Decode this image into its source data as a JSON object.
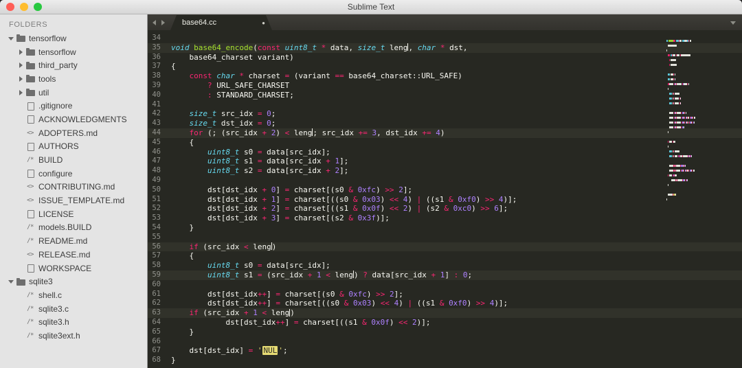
{
  "window": {
    "title": "Sublime Text"
  },
  "colors": {
    "editor_bg": "#272822",
    "sidebar_bg": "#e4e4e4",
    "tab_active_bg": "#272822",
    "plain": "#f8f8f2",
    "keyword": "#f92672",
    "type": "#66d9ef",
    "function": "#a6e22e",
    "number": "#ae81ff",
    "string": "#e6db74",
    "line_number": "#90918b",
    "line_highlight": "#31322a",
    "titlebar_close": "#ff5f57",
    "titlebar_minimize": "#ffbd2e",
    "titlebar_zoom": "#28c840"
  },
  "sidebar": {
    "header": "FOLDERS",
    "items": [
      {
        "label": "tensorflow",
        "type": "folder-open",
        "level": 0
      },
      {
        "label": "tensorflow",
        "type": "folder",
        "level": 1
      },
      {
        "label": "third_party",
        "type": "folder",
        "level": 1
      },
      {
        "label": "tools",
        "type": "folder",
        "level": 1
      },
      {
        "label": "util",
        "type": "folder",
        "level": 1
      },
      {
        "label": ".gitignore",
        "type": "doc",
        "level": 1
      },
      {
        "label": "ACKNOWLEDGMENTS",
        "type": "doc",
        "level": 1
      },
      {
        "label": "ADOPTERS.md",
        "type": "code",
        "level": 1
      },
      {
        "label": "AUTHORS",
        "type": "doc",
        "level": 1
      },
      {
        "label": "BUILD",
        "type": "src",
        "level": 1
      },
      {
        "label": "configure",
        "type": "doc",
        "level": 1
      },
      {
        "label": "CONTRIBUTING.md",
        "type": "code",
        "level": 1
      },
      {
        "label": "ISSUE_TEMPLATE.md",
        "type": "code",
        "level": 1
      },
      {
        "label": "LICENSE",
        "type": "doc",
        "level": 1
      },
      {
        "label": "models.BUILD",
        "type": "src",
        "level": 1
      },
      {
        "label": "README.md",
        "type": "src",
        "level": 1
      },
      {
        "label": "RELEASE.md",
        "type": "code",
        "level": 1
      },
      {
        "label": "WORKSPACE",
        "type": "doc",
        "level": 1
      },
      {
        "label": "sqlite3",
        "type": "folder-open",
        "level": 0
      },
      {
        "label": "shell.c",
        "type": "src",
        "level": 1
      },
      {
        "label": "sqlite3.c",
        "type": "src",
        "level": 1
      },
      {
        "label": "sqlite3.h",
        "type": "src",
        "level": 1
      },
      {
        "label": "sqlite3ext.h",
        "type": "src",
        "level": 1
      }
    ]
  },
  "tab_bar": {
    "tabs": [
      {
        "label": "base64.cc",
        "modified": true,
        "active": true
      }
    ]
  },
  "editor": {
    "first_visible_line": 34,
    "last_visible_line": 68,
    "lines": [
      {
        "n": 34,
        "t": []
      },
      {
        "n": 35,
        "hl": true,
        "t": [
          [
            "t",
            "void "
          ],
          [
            "f",
            "base64_encode"
          ],
          [
            "p",
            "("
          ],
          [
            "k",
            "const "
          ],
          [
            "t",
            "uint8_t "
          ],
          [
            "o",
            "* "
          ],
          [
            "p",
            "data, "
          ],
          [
            "t",
            "size_t "
          ],
          [
            "p",
            "leng"
          ],
          [
            "caret",
            ""
          ],
          [
            "p",
            ", "
          ],
          [
            "t",
            "char "
          ],
          [
            "o",
            "* "
          ],
          [
            "p",
            "dst,"
          ]
        ]
      },
      {
        "n": 36,
        "t": [
          [
            "p",
            "    base64_charset variant)"
          ]
        ]
      },
      {
        "n": 37,
        "t": [
          [
            "p",
            "{"
          ]
        ]
      },
      {
        "n": 38,
        "t": [
          [
            "p",
            "    "
          ],
          [
            "k",
            "const "
          ],
          [
            "t",
            "char "
          ],
          [
            "o",
            "* "
          ],
          [
            "p",
            "charset "
          ],
          [
            "o",
            "= "
          ],
          [
            "p",
            "(variant "
          ],
          [
            "o",
            "== "
          ],
          [
            "p",
            "base64_charset::URL_SAFE)"
          ]
        ]
      },
      {
        "n": 39,
        "t": [
          [
            "p",
            "        "
          ],
          [
            "o",
            "? "
          ],
          [
            "p",
            "URL_SAFE_CHARSET"
          ]
        ]
      },
      {
        "n": 40,
        "t": [
          [
            "p",
            "        "
          ],
          [
            "o",
            ": "
          ],
          [
            "p",
            "STANDARD_CHARSET;"
          ]
        ]
      },
      {
        "n": 41,
        "t": []
      },
      {
        "n": 42,
        "t": [
          [
            "p",
            "    "
          ],
          [
            "t",
            "size_t "
          ],
          [
            "p",
            "src_idx "
          ],
          [
            "o",
            "= "
          ],
          [
            "n",
            "0"
          ],
          [
            "p",
            ";"
          ]
        ]
      },
      {
        "n": 43,
        "t": [
          [
            "p",
            "    "
          ],
          [
            "t",
            "size_t "
          ],
          [
            "p",
            "dst_idx "
          ],
          [
            "o",
            "= "
          ],
          [
            "n",
            "0"
          ],
          [
            "p",
            ";"
          ]
        ]
      },
      {
        "n": 44,
        "hl": true,
        "t": [
          [
            "p",
            "    "
          ],
          [
            "k",
            "for "
          ],
          [
            "p",
            "(; (src_idx "
          ],
          [
            "o",
            "+ "
          ],
          [
            "n",
            "2"
          ],
          [
            "p",
            ") "
          ],
          [
            "o",
            "< "
          ],
          [
            "p",
            "leng"
          ],
          [
            "caret",
            ""
          ],
          [
            "p",
            "; src_idx "
          ],
          [
            "o",
            "+= "
          ],
          [
            "n",
            "3"
          ],
          [
            "p",
            ", dst_idx "
          ],
          [
            "o",
            "+= "
          ],
          [
            "n",
            "4"
          ],
          [
            "p",
            ")"
          ]
        ]
      },
      {
        "n": 45,
        "t": [
          [
            "p",
            "    {"
          ]
        ]
      },
      {
        "n": 46,
        "t": [
          [
            "p",
            "        "
          ],
          [
            "t",
            "uint8_t "
          ],
          [
            "p",
            "s0 "
          ],
          [
            "o",
            "= "
          ],
          [
            "p",
            "data[src_idx];"
          ]
        ]
      },
      {
        "n": 47,
        "t": [
          [
            "p",
            "        "
          ],
          [
            "t",
            "uint8_t "
          ],
          [
            "p",
            "s1 "
          ],
          [
            "o",
            "= "
          ],
          [
            "p",
            "data[src_idx "
          ],
          [
            "o",
            "+ "
          ],
          [
            "n",
            "1"
          ],
          [
            "p",
            "];"
          ]
        ]
      },
      {
        "n": 48,
        "t": [
          [
            "p",
            "        "
          ],
          [
            "t",
            "uint8_t "
          ],
          [
            "p",
            "s2 "
          ],
          [
            "o",
            "= "
          ],
          [
            "p",
            "data[src_idx "
          ],
          [
            "o",
            "+ "
          ],
          [
            "n",
            "2"
          ],
          [
            "p",
            "];"
          ]
        ]
      },
      {
        "n": 49,
        "t": []
      },
      {
        "n": 50,
        "t": [
          [
            "p",
            "        dst[dst_idx "
          ],
          [
            "o",
            "+ "
          ],
          [
            "n",
            "0"
          ],
          [
            "p",
            "] "
          ],
          [
            "o",
            "= "
          ],
          [
            "p",
            "charset[(s0 "
          ],
          [
            "o",
            "& "
          ],
          [
            "n",
            "0xfc"
          ],
          [
            "p",
            ") "
          ],
          [
            "o",
            ">> "
          ],
          [
            "n",
            "2"
          ],
          [
            "p",
            "];"
          ]
        ]
      },
      {
        "n": 51,
        "t": [
          [
            "p",
            "        dst[dst_idx "
          ],
          [
            "o",
            "+ "
          ],
          [
            "n",
            "1"
          ],
          [
            "p",
            "] "
          ],
          [
            "o",
            "= "
          ],
          [
            "p",
            "charset[((s0 "
          ],
          [
            "o",
            "& "
          ],
          [
            "n",
            "0x03"
          ],
          [
            "p",
            ") "
          ],
          [
            "o",
            "<< "
          ],
          [
            "n",
            "4"
          ],
          [
            "p",
            ") "
          ],
          [
            "o",
            "| "
          ],
          [
            "p",
            "((s1 "
          ],
          [
            "o",
            "& "
          ],
          [
            "n",
            "0xf0"
          ],
          [
            "p",
            ") "
          ],
          [
            "o",
            ">> "
          ],
          [
            "n",
            "4"
          ],
          [
            "p",
            ")];"
          ]
        ]
      },
      {
        "n": 52,
        "t": [
          [
            "p",
            "        dst[dst_idx "
          ],
          [
            "o",
            "+ "
          ],
          [
            "n",
            "2"
          ],
          [
            "p",
            "] "
          ],
          [
            "o",
            "= "
          ],
          [
            "p",
            "charset[((s1 "
          ],
          [
            "o",
            "& "
          ],
          [
            "n",
            "0x0f"
          ],
          [
            "p",
            ") "
          ],
          [
            "o",
            "<< "
          ],
          [
            "n",
            "2"
          ],
          [
            "p",
            ") "
          ],
          [
            "o",
            "| "
          ],
          [
            "p",
            "(s2 "
          ],
          [
            "o",
            "& "
          ],
          [
            "n",
            "0xc0"
          ],
          [
            "p",
            ") "
          ],
          [
            "o",
            ">> "
          ],
          [
            "n",
            "6"
          ],
          [
            "p",
            "];"
          ]
        ]
      },
      {
        "n": 53,
        "t": [
          [
            "p",
            "        dst[dst_idx "
          ],
          [
            "o",
            "+ "
          ],
          [
            "n",
            "3"
          ],
          [
            "p",
            "] "
          ],
          [
            "o",
            "= "
          ],
          [
            "p",
            "charset[(s2 "
          ],
          [
            "o",
            "& "
          ],
          [
            "n",
            "0x3f"
          ],
          [
            "p",
            ")];"
          ]
        ]
      },
      {
        "n": 54,
        "t": [
          [
            "p",
            "    }"
          ]
        ]
      },
      {
        "n": 55,
        "t": []
      },
      {
        "n": 56,
        "hl": true,
        "t": [
          [
            "p",
            "    "
          ],
          [
            "k",
            "if "
          ],
          [
            "p",
            "(src_idx "
          ],
          [
            "o",
            "< "
          ],
          [
            "p",
            "leng"
          ],
          [
            "caret",
            ""
          ],
          [
            "p",
            ")"
          ]
        ]
      },
      {
        "n": 57,
        "t": [
          [
            "p",
            "    {"
          ]
        ]
      },
      {
        "n": 58,
        "t": [
          [
            "p",
            "        "
          ],
          [
            "t",
            "uint8_t "
          ],
          [
            "p",
            "s0 "
          ],
          [
            "o",
            "= "
          ],
          [
            "p",
            "data[src_idx];"
          ]
        ]
      },
      {
        "n": 59,
        "hl": true,
        "t": [
          [
            "p",
            "        "
          ],
          [
            "t",
            "uint8_t "
          ],
          [
            "p",
            "s1 "
          ],
          [
            "o",
            "= "
          ],
          [
            "p",
            "(src_idx "
          ],
          [
            "o",
            "+ "
          ],
          [
            "n",
            "1 "
          ],
          [
            "o",
            "< "
          ],
          [
            "p",
            "leng"
          ],
          [
            "caret",
            ""
          ],
          [
            "p",
            ") "
          ],
          [
            "o",
            "? "
          ],
          [
            "p",
            "data[src_idx "
          ],
          [
            "o",
            "+ "
          ],
          [
            "n",
            "1"
          ],
          [
            "p",
            "] "
          ],
          [
            "o",
            ": "
          ],
          [
            "n",
            "0"
          ],
          [
            "p",
            ";"
          ]
        ]
      },
      {
        "n": 60,
        "t": []
      },
      {
        "n": 61,
        "t": [
          [
            "p",
            "        dst[dst_idx"
          ],
          [
            "o",
            "++"
          ],
          [
            "p",
            "] "
          ],
          [
            "o",
            "= "
          ],
          [
            "p",
            "charset[(s0 "
          ],
          [
            "o",
            "& "
          ],
          [
            "n",
            "0xfc"
          ],
          [
            "p",
            ") "
          ],
          [
            "o",
            ">> "
          ],
          [
            "n",
            "2"
          ],
          [
            "p",
            "];"
          ]
        ]
      },
      {
        "n": 62,
        "t": [
          [
            "p",
            "        dst[dst_idx"
          ],
          [
            "o",
            "++"
          ],
          [
            "p",
            "] "
          ],
          [
            "o",
            "= "
          ],
          [
            "p",
            "charset[((s0 "
          ],
          [
            "o",
            "& "
          ],
          [
            "n",
            "0x03"
          ],
          [
            "p",
            ") "
          ],
          [
            "o",
            "<< "
          ],
          [
            "n",
            "4"
          ],
          [
            "p",
            ") "
          ],
          [
            "o",
            "| "
          ],
          [
            "p",
            "((s1 "
          ],
          [
            "o",
            "& "
          ],
          [
            "n",
            "0xf0"
          ],
          [
            "p",
            ") "
          ],
          [
            "o",
            ">> "
          ],
          [
            "n",
            "4"
          ],
          [
            "p",
            ")];"
          ]
        ]
      },
      {
        "n": 63,
        "hl": true,
        "t": [
          [
            "p",
            "    "
          ],
          [
            "k",
            "if "
          ],
          [
            "p",
            "(src_idx "
          ],
          [
            "o",
            "+ "
          ],
          [
            "n",
            "1 "
          ],
          [
            "o",
            "< "
          ],
          [
            "p",
            "leng"
          ],
          [
            "caret",
            ""
          ],
          [
            "p",
            ")"
          ]
        ]
      },
      {
        "n": 64,
        "t": [
          [
            "p",
            "            dst[dst_idx"
          ],
          [
            "o",
            "++"
          ],
          [
            "p",
            "] "
          ],
          [
            "o",
            "= "
          ],
          [
            "p",
            "charset[((s1 "
          ],
          [
            "o",
            "& "
          ],
          [
            "n",
            "0x0f"
          ],
          [
            "p",
            ") "
          ],
          [
            "o",
            "<< "
          ],
          [
            "n",
            "2"
          ],
          [
            "p",
            ")];"
          ]
        ]
      },
      {
        "n": 65,
        "t": [
          [
            "p",
            "    }"
          ]
        ]
      },
      {
        "n": 66,
        "t": []
      },
      {
        "n": 67,
        "t": [
          [
            "p",
            "    dst[dst_idx] "
          ],
          [
            "o",
            "= "
          ],
          [
            "s",
            "'"
          ],
          [
            "nul",
            "NUL"
          ],
          [
            "s",
            "'"
          ],
          [
            "p",
            ";"
          ]
        ]
      },
      {
        "n": 68,
        "t": [
          [
            "p",
            "}"
          ]
        ]
      }
    ]
  }
}
